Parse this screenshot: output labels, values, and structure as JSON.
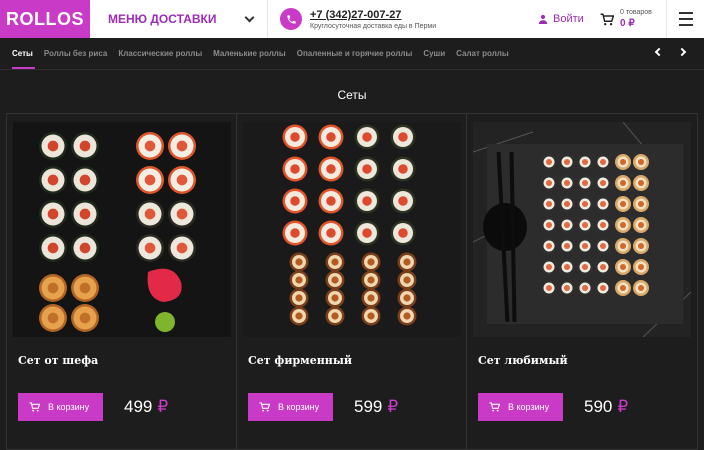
{
  "header": {
    "logo": "ROLLOS",
    "menu_label": "МЕНЮ ДОСТАВКИ",
    "phone": "+7 (342)27-007-27",
    "phone_sub": "Круглосуточная доставка еды в Перми",
    "login_label": "Войти",
    "cart_count": "0 товаров",
    "cart_sum": "0 ₽"
  },
  "tabs": [
    "Сеты",
    "Роллы без риса",
    "Классические роллы",
    "Маленькие роллы",
    "Опаленные и горячие роллы",
    "Суши",
    "Салат роллы"
  ],
  "section_title": "Сеты",
  "products": [
    {
      "title": "Сет от шефа",
      "button": "В корзину",
      "price": "499",
      "currency": "₽"
    },
    {
      "title": "Сет фирменный",
      "button": "В корзину",
      "price": "599",
      "currency": "₽"
    },
    {
      "title": "Сет любимый",
      "button": "В корзину",
      "price": "590",
      "currency": "₽"
    }
  ],
  "colors": {
    "accent": "#c93ac6",
    "background": "#1d1d1d"
  }
}
